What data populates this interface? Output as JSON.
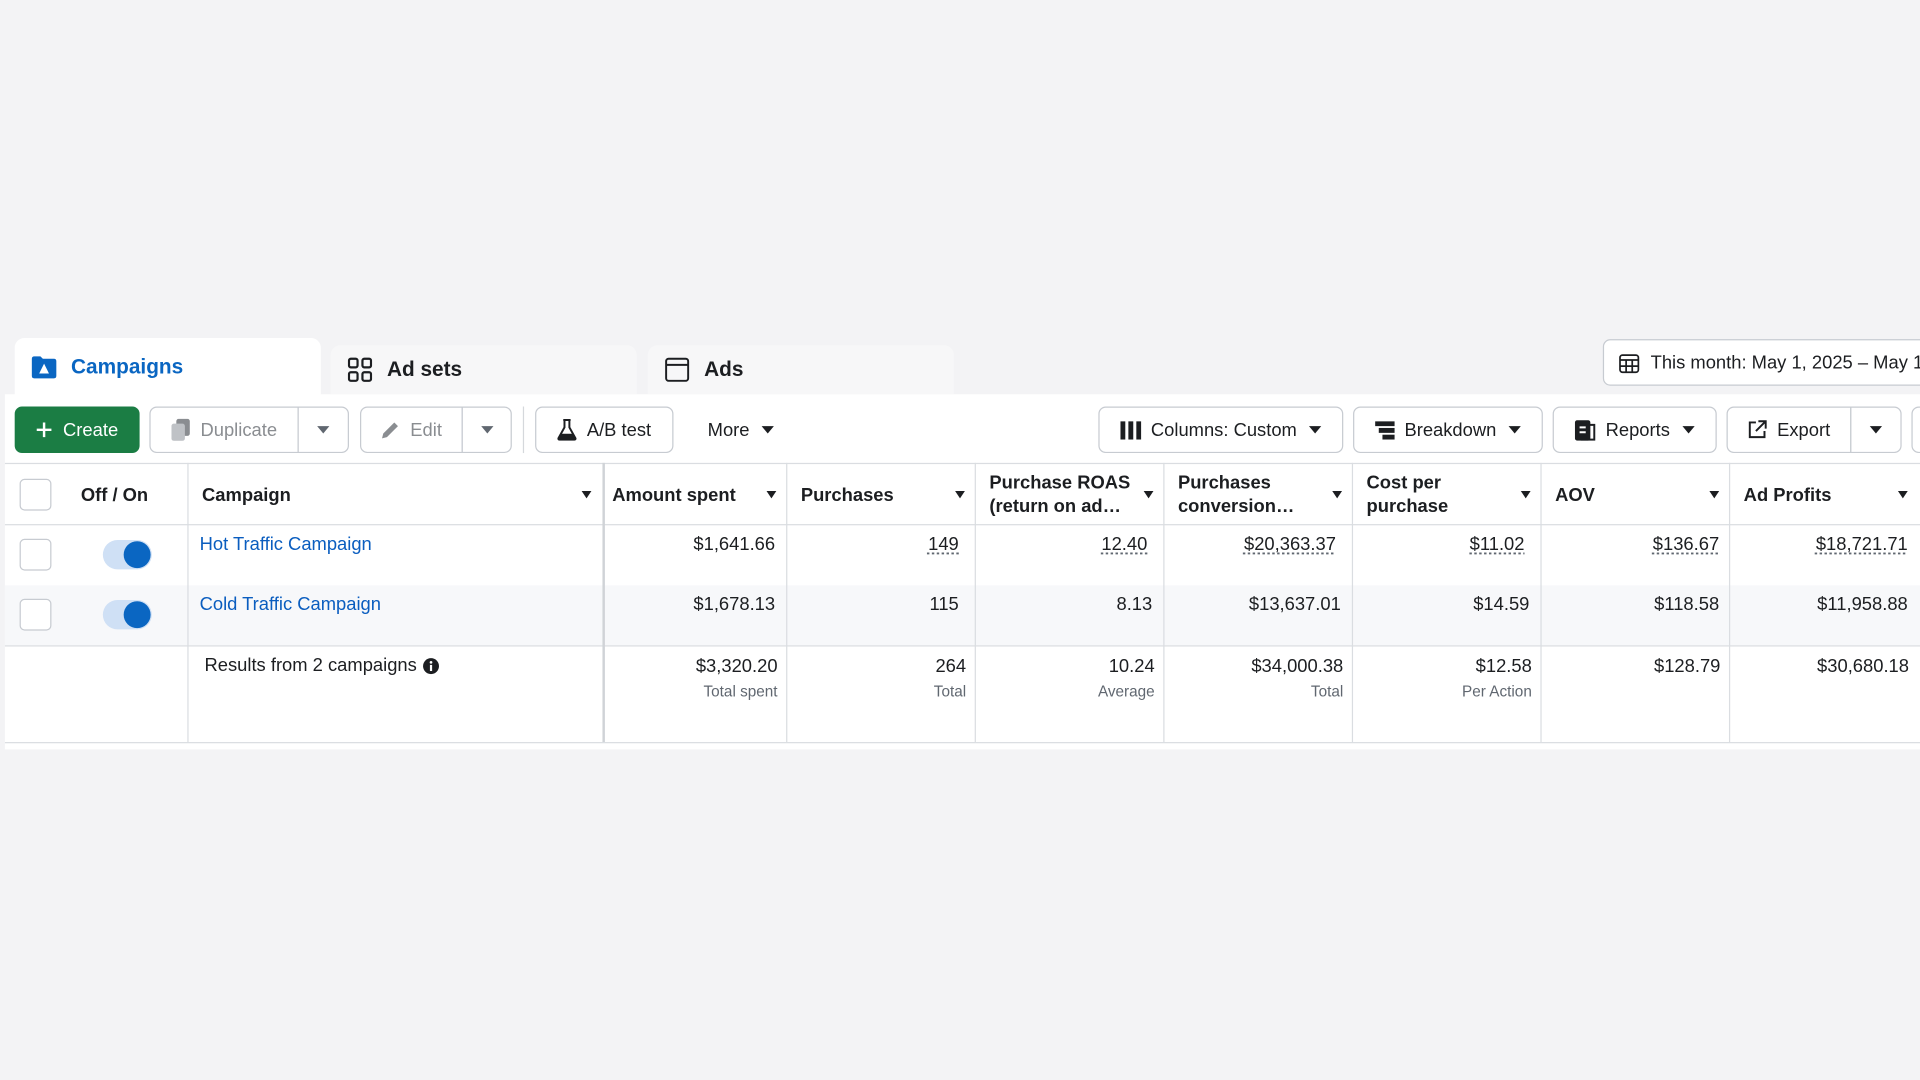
{
  "tabs": [
    {
      "label": "Campaigns",
      "icon": "campaigns-folder-icon",
      "active": true
    },
    {
      "label": "Ad sets",
      "icon": "grid-icon"
    },
    {
      "label": "Ads",
      "icon": "ad-window-icon"
    }
  ],
  "date_range": "This month: May 1, 2025 – May 1",
  "toolbar": {
    "create": "Create",
    "duplicate": "Duplicate",
    "edit": "Edit",
    "ab_test": "A/B test",
    "more": "More",
    "columns": "Columns: Custom",
    "breakdown": "Breakdown",
    "reports": "Reports",
    "export": "Export"
  },
  "table": {
    "headers": {
      "toggle": "Off / On",
      "campaign": "Campaign",
      "amount_spent": "Amount spent",
      "purchases": "Purchases",
      "roas_1": "Purchase ROAS",
      "roas_2": "(return on ad…",
      "conv_1": "Purchases",
      "conv_2": "conversion…",
      "cpp_1": "Cost per",
      "cpp_2": "purchase",
      "aov": "AOV",
      "ad_profits": "Ad Profits"
    },
    "rows": [
      {
        "campaign": "Hot Traffic Campaign",
        "on": true,
        "amount_spent": "$1,641.66",
        "purchases": "149",
        "roas": "12.40",
        "conversion": "$20,363.37",
        "cost_per_purchase": "$11.02",
        "aov": "$136.67",
        "ad_profits": "$18,721.71"
      },
      {
        "campaign": "Cold Traffic Campaign",
        "on": true,
        "amount_spent": "$1,678.13",
        "purchases": "115",
        "roas": "8.13",
        "conversion": "$13,637.01",
        "cost_per_purchase": "$14.59",
        "aov": "$118.58",
        "ad_profits": "$11,958.88"
      }
    ],
    "totals": {
      "label": "Results from 2 campaigns",
      "amount_spent": "$3,320.20",
      "amount_spent_sub": "Total spent",
      "purchases": "264",
      "purchases_sub": "Total",
      "roas": "10.24",
      "roas_sub": "Average",
      "conversion": "$34,000.38",
      "conversion_sub": "Total",
      "cost_per_purchase": "$12.58",
      "cost_per_purchase_sub": "Per Action",
      "aov": "$128.79",
      "ad_profits": "$30,680.18"
    }
  },
  "colors": {
    "primary_blue": "#0a66c2",
    "create_green": "#1b7d44",
    "link_blue": "#0a5dbf"
  }
}
